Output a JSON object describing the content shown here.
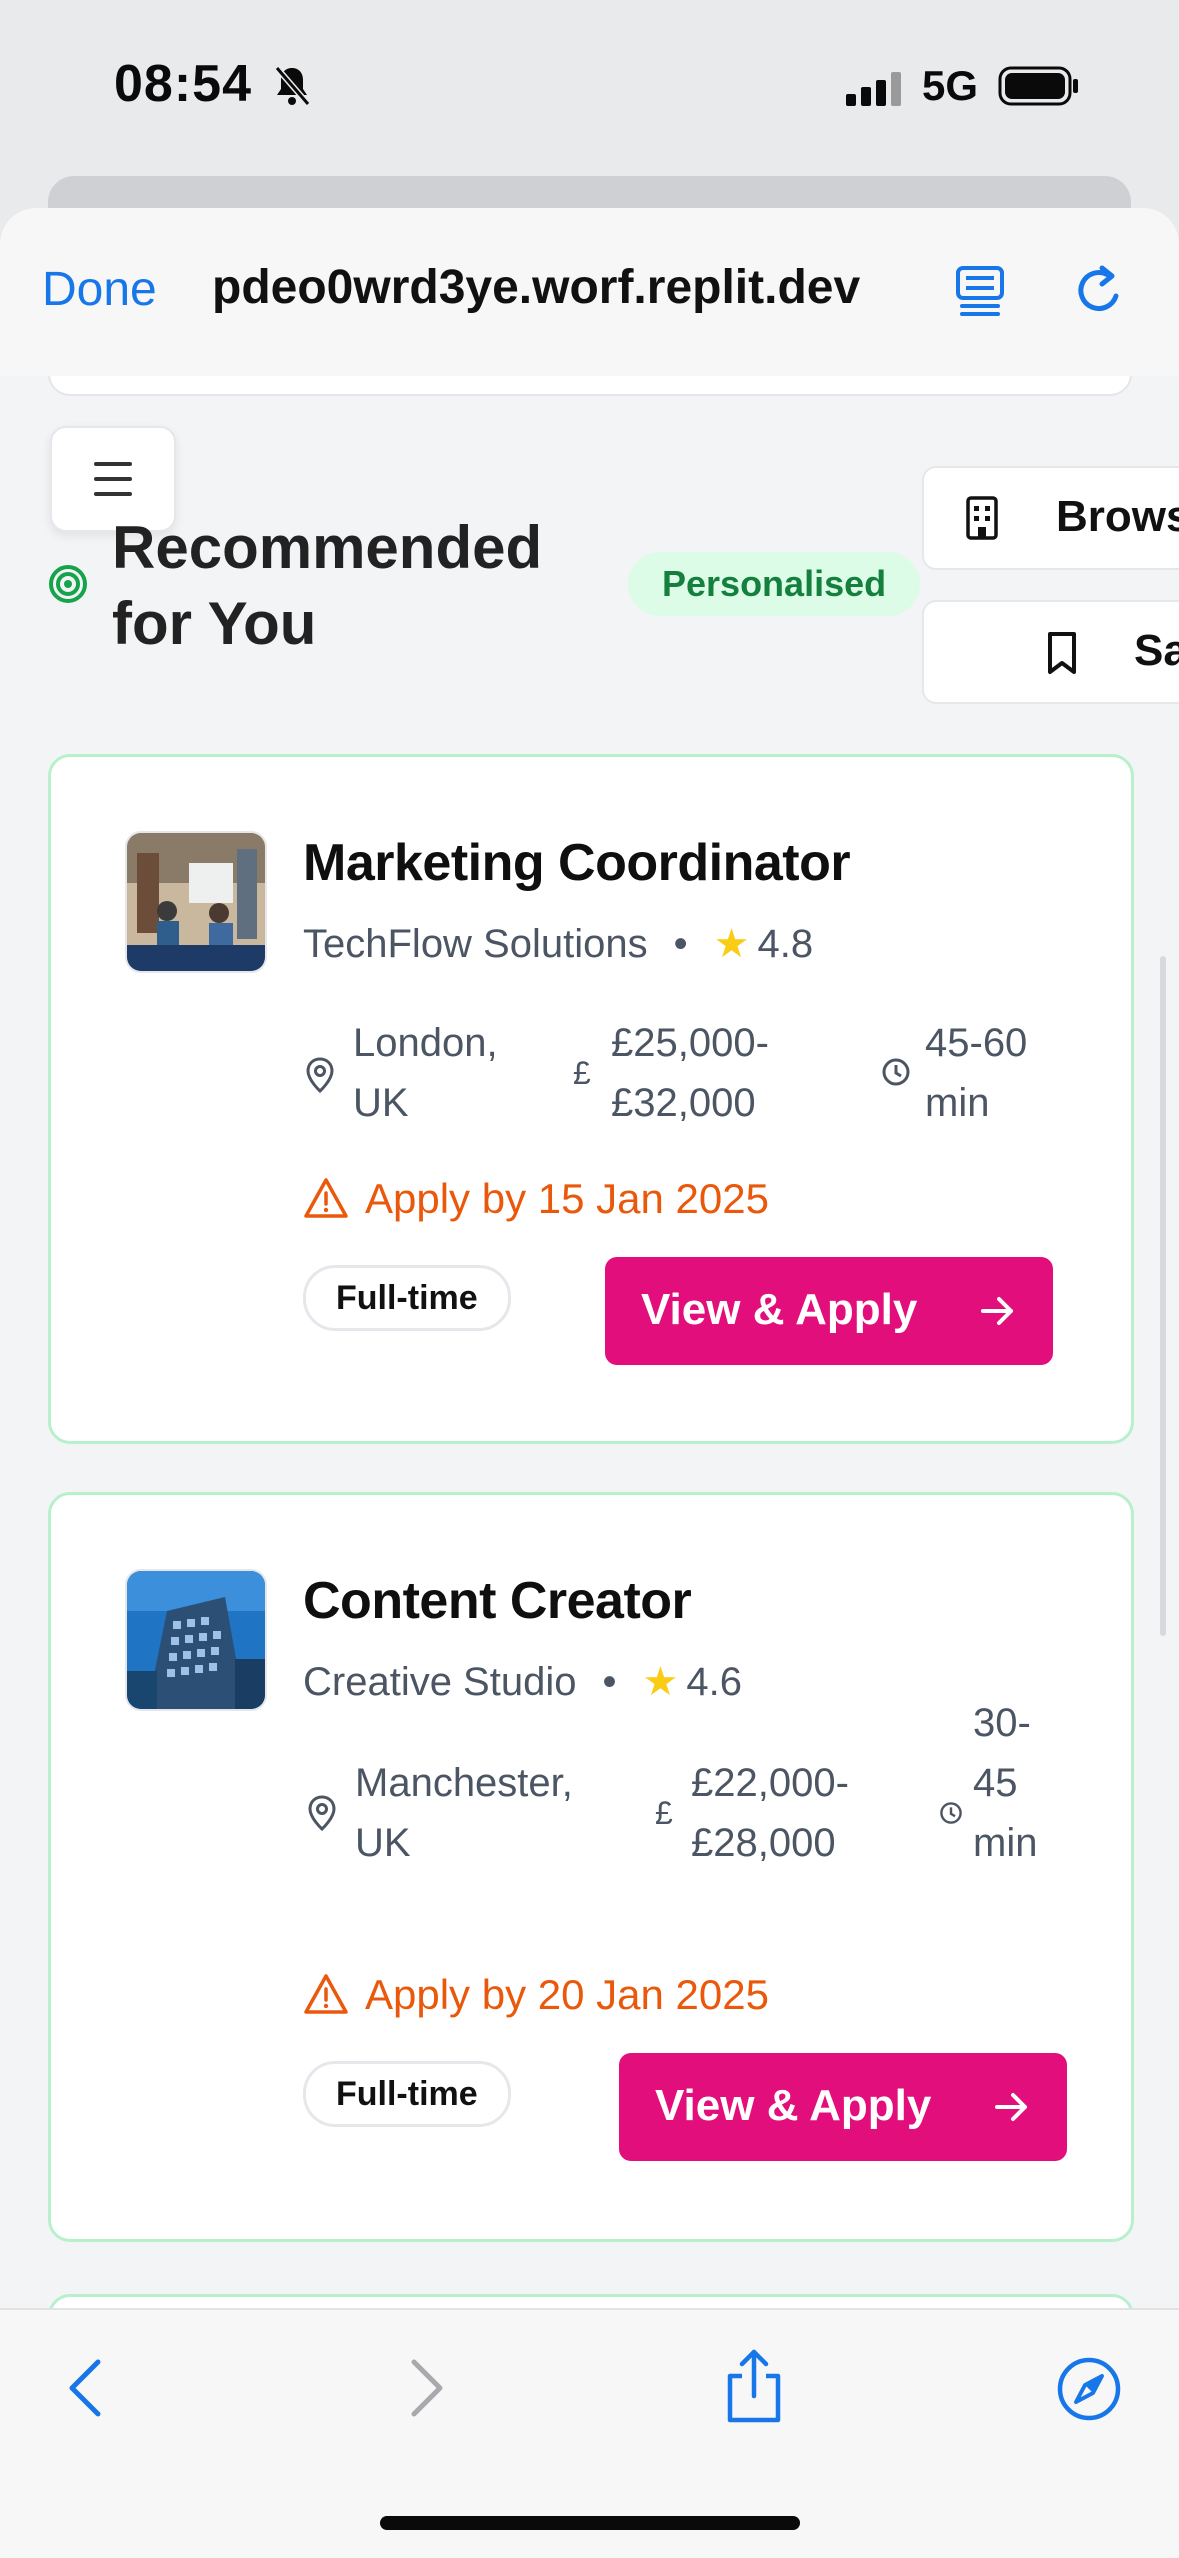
{
  "status": {
    "time": "08:54",
    "network": "5G"
  },
  "browser": {
    "done_label": "Done",
    "url": "pdeo0wrd3ye.worf.replit.dev"
  },
  "section": {
    "title": "Recommended for You",
    "badge": "Personalised"
  },
  "side_buttons": [
    {
      "label": "Brows",
      "icon": "building-icon"
    },
    {
      "label": "Sa",
      "icon": "bookmark-icon"
    }
  ],
  "jobs": [
    {
      "title": "Marketing Coordinator",
      "company": "TechFlow Solutions",
      "rating": "4.8",
      "location": "London, UK",
      "salary": "£25,000-£32,000",
      "duration": "45-60 min",
      "deadline": "Apply by 15 Jan 2025",
      "type": "Full-time",
      "cta": "View & Apply",
      "logo": "office-meeting-photo"
    },
    {
      "title": "Content Creator",
      "company": "Creative Studio",
      "rating": "4.6",
      "location": "Manchester, UK",
      "salary": "£22,000-£28,000",
      "duration": "30-45 min",
      "deadline": "Apply by 20 Jan 2025",
      "type": "Full-time",
      "cta": "View & Apply",
      "logo": "building-photo"
    }
  ],
  "colors": {
    "accent": "#e20e7c",
    "link_blue": "#1877e8",
    "card_border": "#b8f0cc",
    "badge_bg": "#dcfce7",
    "badge_text": "#15803d",
    "deadline": "#ea580c",
    "star": "#facc15"
  }
}
